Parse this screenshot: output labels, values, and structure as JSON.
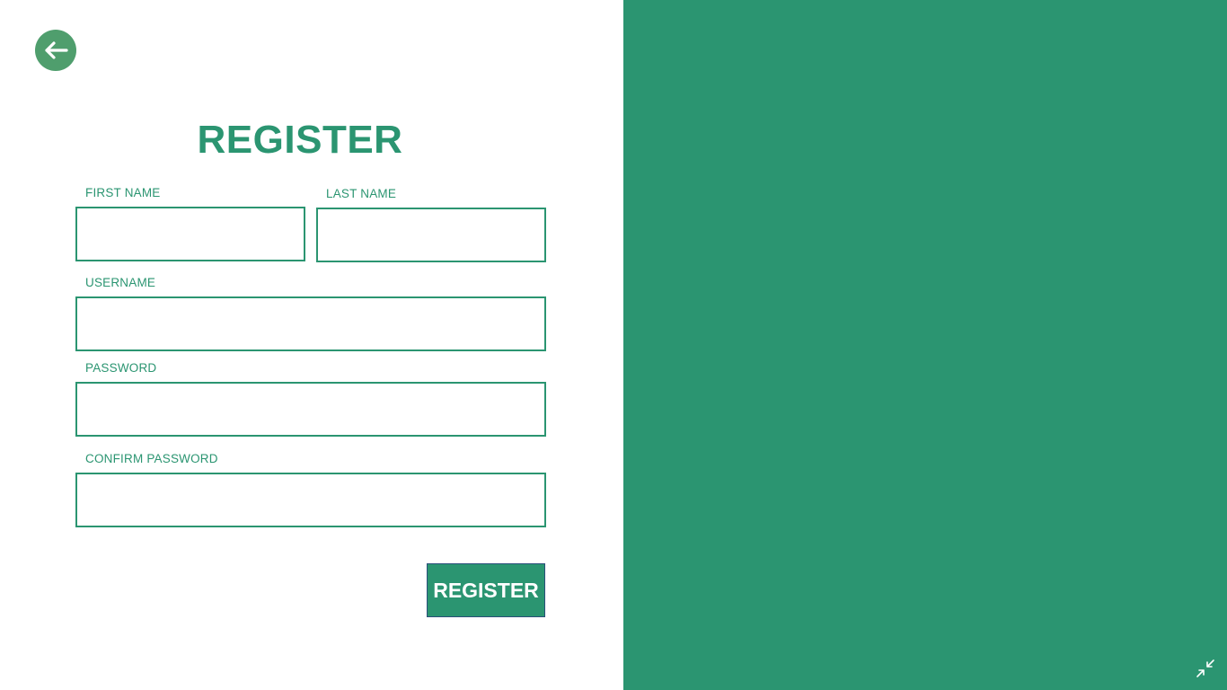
{
  "form": {
    "title": "REGISTER",
    "first_name_label": "FIRST NAME",
    "first_name_value": "",
    "last_name_label": "LAST NAME",
    "last_name_value": "",
    "username_label": "USERNAME",
    "username_value": "",
    "password_label": "PASSWORD",
    "password_value": "",
    "confirm_password_label": "CONFIRM PASSWORD",
    "confirm_password_value": "",
    "submit_label": "REGISTER"
  },
  "icons": {
    "back": "arrow-left-icon",
    "restore": "collapse-arrows-icon"
  },
  "colors": {
    "accent": "#2b9571",
    "back_button": "#4f9e6d",
    "background": "#ffffff"
  }
}
